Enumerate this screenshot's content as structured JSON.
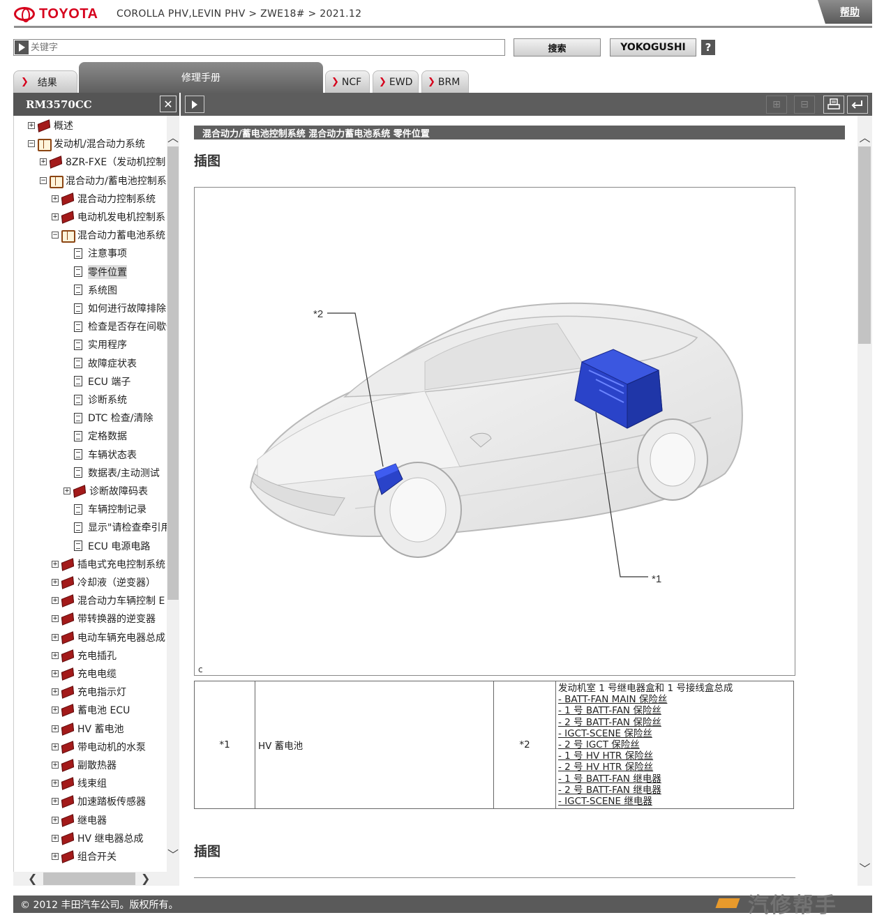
{
  "header": {
    "brand": "TOYOTA",
    "breadcrumb": "COROLLA PHV,LEVIN PHV > ZWE18# > 2021.12",
    "help": "帮助"
  },
  "search": {
    "placeholder": "关键字",
    "button": "搜索",
    "yokogushi": "YOKOGUSHI",
    "question": "?"
  },
  "tabs": [
    {
      "label": "结果"
    },
    {
      "label": "修理手册"
    },
    {
      "label": "NCF"
    },
    {
      "label": "EWD"
    },
    {
      "label": "BRM"
    }
  ],
  "left_panel": {
    "code": "RM3570CC",
    "close": "✕"
  },
  "toolbar": {
    "expand_icon": "expand-icon",
    "collapse_icon": "collapse-icon",
    "print_icon": "print-icon",
    "back_icon": "back-icon"
  },
  "tree": [
    {
      "label": "概述",
      "level": 0,
      "type": "closed"
    },
    {
      "label": "发动机/混合动力系统",
      "level": 0,
      "type": "open"
    },
    {
      "label": "8ZR-FXE（发动机控制",
      "level": 1,
      "type": "closed"
    },
    {
      "label": "混合动力/蓄电池控制系",
      "level": 1,
      "type": "open"
    },
    {
      "label": "混合动力控制系统",
      "level": 2,
      "type": "closed"
    },
    {
      "label": "电动机发电机控制系",
      "level": 2,
      "type": "closed"
    },
    {
      "label": "混合动力蓄电池系统",
      "level": 2,
      "type": "open"
    },
    {
      "label": "注意事项",
      "level": 3,
      "type": "doc"
    },
    {
      "label": "零件位置",
      "level": 3,
      "type": "doc",
      "selected": true
    },
    {
      "label": "系统图",
      "level": 3,
      "type": "doc"
    },
    {
      "label": "如何进行故障排除",
      "level": 3,
      "type": "doc"
    },
    {
      "label": "检查是否存在间歇性",
      "level": 3,
      "type": "doc"
    },
    {
      "label": "实用程序",
      "level": 3,
      "type": "doc"
    },
    {
      "label": "故障症状表",
      "level": 3,
      "type": "doc"
    },
    {
      "label": "ECU 端子",
      "level": 3,
      "type": "doc"
    },
    {
      "label": "诊断系统",
      "level": 3,
      "type": "doc"
    },
    {
      "label": "DTC 检查/清除",
      "level": 3,
      "type": "doc"
    },
    {
      "label": "定格数据",
      "level": 3,
      "type": "doc"
    },
    {
      "label": "车辆状态表",
      "level": 3,
      "type": "doc"
    },
    {
      "label": "数据表/主动测试",
      "level": 3,
      "type": "doc"
    },
    {
      "label": "诊断故障码表",
      "level": 3,
      "type": "closed"
    },
    {
      "label": "车辆控制记录",
      "level": 3,
      "type": "doc"
    },
    {
      "label": "显示\"请检查牵引用蓄",
      "level": 3,
      "type": "doc"
    },
    {
      "label": "ECU 电源电路",
      "level": 3,
      "type": "doc"
    },
    {
      "label": "插电式充电控制系统",
      "level": 2,
      "type": "closed"
    },
    {
      "label": "冷却液（逆变器）",
      "level": 2,
      "type": "closed"
    },
    {
      "label": "混合动力车辆控制 E",
      "level": 2,
      "type": "closed"
    },
    {
      "label": "带转换器的逆变器",
      "level": 2,
      "type": "closed"
    },
    {
      "label": "电动车辆充电器总成",
      "level": 2,
      "type": "closed"
    },
    {
      "label": "充电插孔",
      "level": 2,
      "type": "closed"
    },
    {
      "label": "充电电缆",
      "level": 2,
      "type": "closed"
    },
    {
      "label": "充电指示灯",
      "level": 2,
      "type": "closed"
    },
    {
      "label": "蓄电池 ECU",
      "level": 2,
      "type": "closed"
    },
    {
      "label": "HV 蓄电池",
      "level": 2,
      "type": "closed"
    },
    {
      "label": "带电动机的水泵",
      "level": 2,
      "type": "closed"
    },
    {
      "label": "副散热器",
      "level": 2,
      "type": "closed"
    },
    {
      "label": "线束组",
      "level": 2,
      "type": "closed"
    },
    {
      "label": "加速踏板传感器",
      "level": 2,
      "type": "closed"
    },
    {
      "label": "继电器",
      "level": 2,
      "type": "closed"
    },
    {
      "label": "HV 继电器总成",
      "level": 2,
      "type": "closed"
    },
    {
      "label": "组合开关",
      "level": 2,
      "type": "closed"
    }
  ],
  "content": {
    "section_title": "混合动力/蓄电池控制系统  混合动力蓄电池系统  零件位置",
    "figure_heading": "插图",
    "figure_heading2": "插图",
    "figure_letter": "c",
    "callout1": "*1",
    "callout2": "*2",
    "legend": {
      "r1_key": "*1",
      "r1_val": "HV 蓄电池",
      "r2_key": "*2",
      "r2_lines": [
        "发动机室 1 号继电器盒和 1 号接线盒总成",
        "- BATT-FAN MAIN 保险丝",
        "- 1 号 BATT-FAN 保险丝",
        "- 2 号 BATT-FAN 保险丝",
        "- IGCT-SCENE 保险丝",
        "- 2 号 IGCT 保险丝",
        "- 1 号 HV HTR 保险丝",
        "- 2 号 HV HTR 保险丝",
        "- 1 号 BATT-FAN 继电器",
        "- 2 号 BATT-FAN 继电器",
        "- IGCT-SCENE 继电器"
      ]
    }
  },
  "footer": {
    "copyright": "© 2012 丰田汽车公司。版权所有。",
    "watermark": "汽修帮手"
  },
  "colors": {
    "brand_red": "#d6001c",
    "dark_bar": "#5a5a5a",
    "part_blue": "#2a43c9"
  }
}
